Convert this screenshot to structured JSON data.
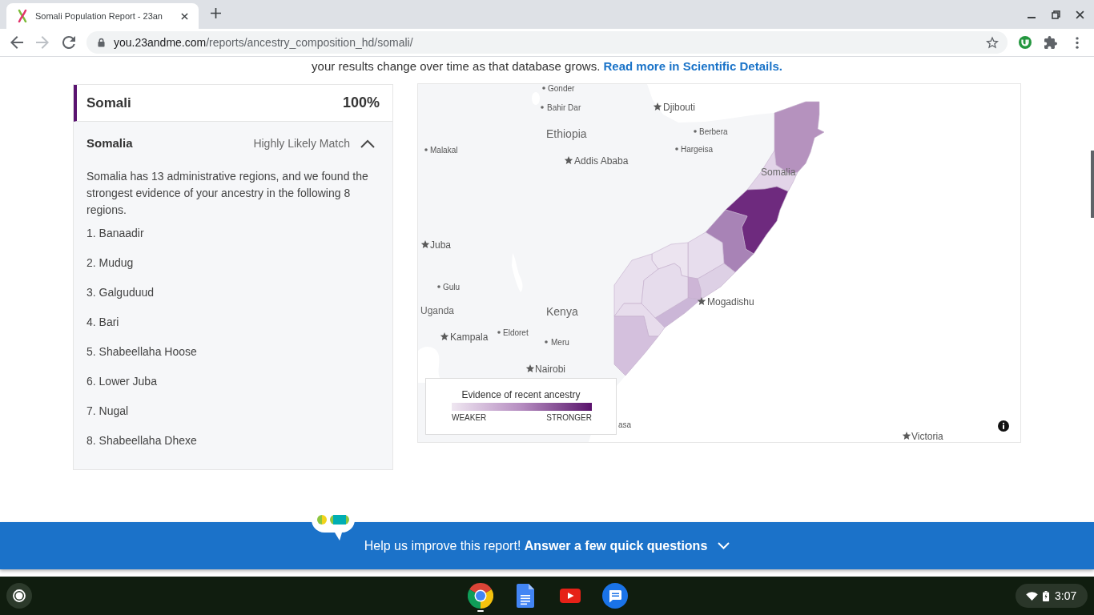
{
  "browser": {
    "tab_title": "Somali Population Report - 23an",
    "url_host": "you.23andme.com",
    "url_path": "/reports/ancestry_composition_hd/somali/"
  },
  "intro": {
    "text": "your results change over time as that database grows.",
    "link": "Read more in Scientific Details."
  },
  "ancestry_panel": {
    "population": "Somali",
    "percent": "100%",
    "country": "Somalia",
    "confidence": "Highly Likely Match",
    "expanded": true,
    "description": "Somalia has 13 administrative regions, and we found the strongest evidence of your ancestry in the following 8 regions.",
    "regions": [
      "1. Banaadir",
      "2. Mudug",
      "3. Galguduud",
      "4. Bari",
      "5. Shabeellaha Hoose",
      "6. Lower Juba",
      "7. Nugal",
      "8. Shabeellaha Dhexe"
    ]
  },
  "map": {
    "regions": [
      {
        "color": "#b592be"
      },
      {
        "color": "#e2d4e8"
      },
      {
        "color": "#6e2a7e"
      },
      {
        "color": "#a883b6"
      },
      {
        "color": "#e7dded"
      },
      {
        "color": "#ddd0e5"
      },
      {
        "color": "#cdb5d6"
      },
      {
        "color": "#cbb6d7"
      },
      {
        "color": "#ece4f0"
      },
      {
        "color": "#e9e0ee"
      },
      {
        "color": "#e6dcec"
      },
      {
        "color": "#e7dcec"
      },
      {
        "color": "#d4c0dd"
      }
    ],
    "labels": [
      {
        "text": "Gonder",
        "kind": "city"
      },
      {
        "text": "Bahir Dar",
        "kind": "city"
      },
      {
        "text": "Djibouti",
        "kind": "capital"
      },
      {
        "text": "Berbera",
        "kind": "city"
      },
      {
        "text": "Ethiopia",
        "kind": "country"
      },
      {
        "text": "Malakal",
        "kind": "city"
      },
      {
        "text": "Hargeisa",
        "kind": "city"
      },
      {
        "text": "Addis Ababa",
        "kind": "capital"
      },
      {
        "text": "Somalia",
        "kind": "country"
      },
      {
        "text": "Juba",
        "kind": "capital"
      },
      {
        "text": "Gulu",
        "kind": "city"
      },
      {
        "text": "Mogadishu",
        "kind": "capital"
      },
      {
        "text": "Uganda",
        "kind": "country"
      },
      {
        "text": "Kenya",
        "kind": "country"
      },
      {
        "text": "Eldoret",
        "kind": "city"
      },
      {
        "text": "Kampala",
        "kind": "capital"
      },
      {
        "text": "Meru",
        "kind": "city"
      },
      {
        "text": "Nairobi",
        "kind": "capital"
      },
      {
        "text": "asa",
        "kind": "fragment"
      },
      {
        "text": "Victoria",
        "kind": "capital"
      }
    ],
    "legend": {
      "title": "Evidence of recent ancestry",
      "low_label": "WEAKER",
      "high_label": "STRONGER"
    }
  },
  "feedback_banner": {
    "text": "Help us improve this report! **Answer a few quick questions**",
    "expanded": false
  },
  "taskbar": {
    "apps": [
      {
        "kind": "chrome",
        "running": true
      },
      {
        "kind": "docs",
        "running": false
      },
      {
        "kind": "youtube",
        "running": false
      },
      {
        "kind": "messages",
        "running": false
      }
    ],
    "time": "3:07"
  }
}
